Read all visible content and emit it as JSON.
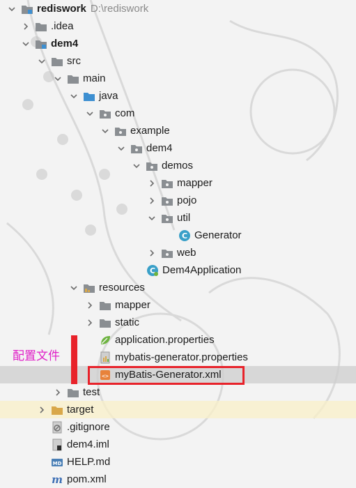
{
  "project": {
    "name": "rediswork",
    "path": "D:\\rediswork"
  },
  "tree": {
    "idea": ".idea",
    "module": "dem4",
    "src": "src",
    "main": "main",
    "java": "java",
    "com": "com",
    "example": "example",
    "dem4pkg": "dem4",
    "demos": "demos",
    "mapper": "mapper",
    "pojo": "pojo",
    "util": "util",
    "generator": "Generator",
    "web": "web",
    "app_class": "Dem4Application",
    "resources": "resources",
    "res_mapper": "mapper",
    "static": "static",
    "app_props": "application.properties",
    "gen_props": "mybatis-generator.properties",
    "gen_xml": "myBatis-Generator.xml",
    "test": "test",
    "target": "target",
    "gitignore": ".gitignore",
    "iml": "dem4.iml",
    "help": "HELP.md",
    "pom": "pom.xml"
  },
  "annotation": {
    "label": "配置文件"
  },
  "colors": {
    "folder": "#8a8e92",
    "source_folder": "#3d8fd1",
    "class_icon": "#3aa0c8",
    "annotation": "#e020c8",
    "highlight": "#e8222a"
  }
}
